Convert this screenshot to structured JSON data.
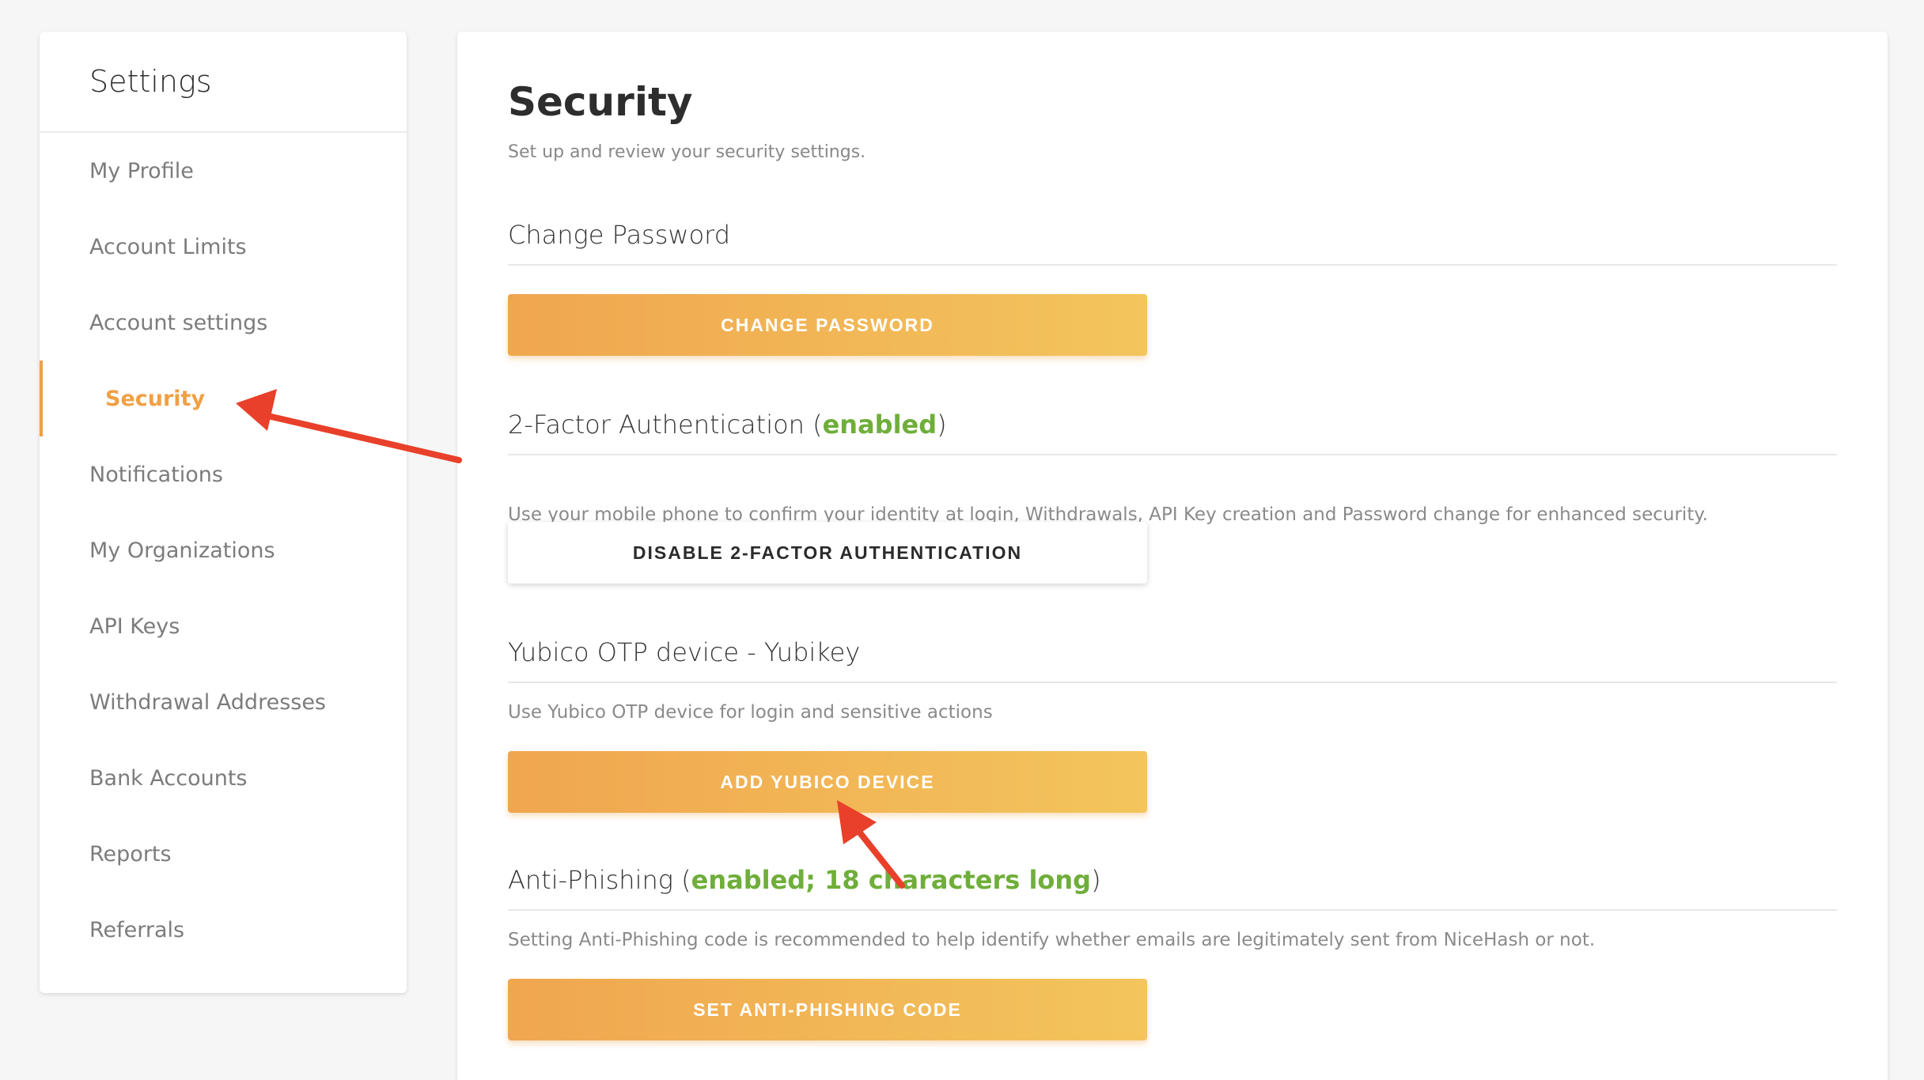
{
  "sidebar": {
    "title": "Settings",
    "items": [
      {
        "label": "My Profile"
      },
      {
        "label": "Account Limits"
      },
      {
        "label": "Account settings"
      },
      {
        "label": "Security"
      },
      {
        "label": "Notifications"
      },
      {
        "label": "My Organizations"
      },
      {
        "label": "API Keys"
      },
      {
        "label": "Withdrawal Addresses"
      },
      {
        "label": "Bank Accounts"
      },
      {
        "label": "Reports"
      },
      {
        "label": "Referrals"
      }
    ],
    "active_item": "Security"
  },
  "main": {
    "title": "Security",
    "subtitle": "Set up and review your security settings.",
    "change_password": {
      "heading": "Change Password",
      "button": "CHANGE PASSWORD"
    },
    "two_factor": {
      "heading": "2-Factor Authentication",
      "status": "enabled",
      "description": "Use your mobile phone to confirm your identity at login, Withdrawals, API Key creation and Password change for enhanced security.",
      "button": "DISABLE 2-FACTOR AUTHENTICATION"
    },
    "yubico": {
      "heading": "Yubico OTP device - Yubikey",
      "description": "Use Yubico OTP device for login and sensitive actions",
      "button": "ADD YUBICO DEVICE"
    },
    "anti_phishing": {
      "heading": "Anti-Phishing",
      "status": "enabled; 18 characters long",
      "description": "Setting Anti-Phishing code is recommended to help identify whether emails are legitimately sent from NiceHash or not.",
      "button": "SET ANTI-PHISHING CODE"
    }
  },
  "colors": {
    "accent": "#f0a045",
    "status_green": "#6fae3a",
    "annotation_red": "#e8402a"
  }
}
